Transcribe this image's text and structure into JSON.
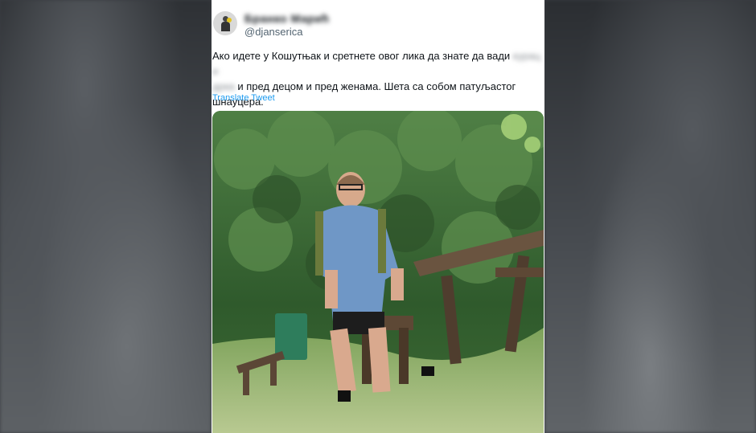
{
  "tweet": {
    "display_name": "Бранко Марић",
    "handle": "@djanserica",
    "text_part1": "Ако идете у Кошутњак и сретнете овог лика да знате да вади ",
    "text_blurred1": "курац и",
    "text_blurred2": "дркa",
    "text_part2": " и пред децом и пред женама. Шета са собом патуљастог шнауцера.",
    "translate_label": "Translate Tweet"
  },
  "media": {
    "description_icon": "photo-icon"
  },
  "colors": {
    "link": "#1d9bf0",
    "text": "#0f1419",
    "muted": "#536471"
  }
}
